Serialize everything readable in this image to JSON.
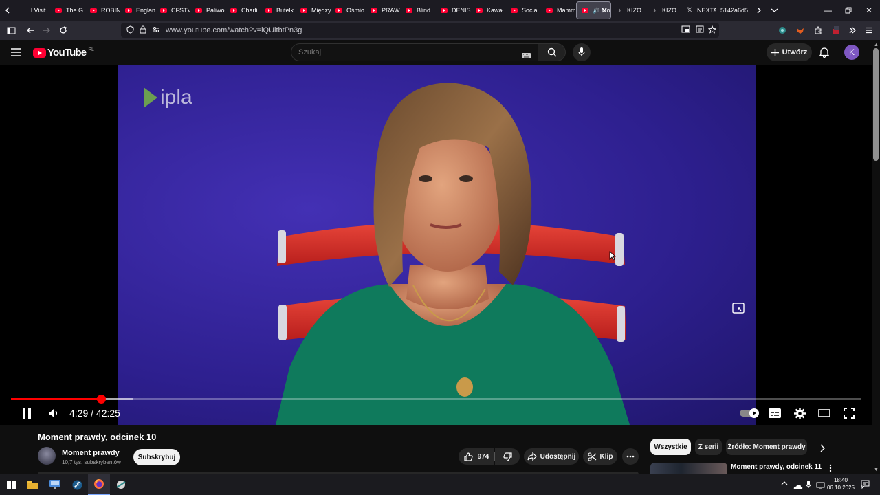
{
  "browser": {
    "tabs": [
      {
        "label": "l Visit",
        "icon": "favicon"
      },
      {
        "label": "The G",
        "icon": "youtube-icon"
      },
      {
        "label": "ROBIN",
        "icon": "youtube-icon"
      },
      {
        "label": "Englan",
        "icon": "youtube-icon"
      },
      {
        "label": "CFSTV",
        "icon": "youtube-icon"
      },
      {
        "label": "Paliwo",
        "icon": "youtube-icon"
      },
      {
        "label": "Charli",
        "icon": "youtube-icon"
      },
      {
        "label": "Butelk",
        "icon": "youtube-icon"
      },
      {
        "label": "Między",
        "icon": "youtube-icon"
      },
      {
        "label": "Ośmio",
        "icon": "youtube-icon"
      },
      {
        "label": "PRAW",
        "icon": "youtube-icon"
      },
      {
        "label": "Blind",
        "icon": "youtube-icon"
      },
      {
        "label": "DENIS",
        "icon": "youtube-icon"
      },
      {
        "label": "Kawał",
        "icon": "youtube-icon"
      },
      {
        "label": "Social",
        "icon": "youtube-icon"
      },
      {
        "label": "Mamm",
        "icon": "youtube-icon"
      },
      {
        "label": "Mo",
        "icon": "youtube-icon",
        "active": true
      },
      {
        "label": "KIZO",
        "icon": "tiktok-icon"
      },
      {
        "label": "KIZO",
        "icon": "tiktok-icon"
      },
      {
        "label": "NEXTA",
        "icon": "x-icon"
      },
      {
        "label": "5142a6d5",
        "icon": "none"
      }
    ],
    "url": "www.youtube.com/watch?v=iQUltbtPn3g"
  },
  "youtube": {
    "logo_text": "YouTube",
    "region": "PL",
    "search_placeholder": "Szukaj",
    "create_label": "Utwórz",
    "avatar_letter": "K",
    "accent": "#ff0033"
  },
  "player": {
    "watermark": "ipla",
    "time": "4:29 / 42:25",
    "progress_fraction": 0.106,
    "buffered_fraction": 0.143
  },
  "video": {
    "title": "Moment prawdy, odcinek 10",
    "channel": "Moment prawdy",
    "subscribers": "10,7 tys. subskrybentów",
    "subscribe_label": "Subskrybuj",
    "likes": "974",
    "share_label": "Udostępnij",
    "clip_label": "Klip"
  },
  "sidebar": {
    "chips": [
      "Wszystkie",
      "Z serii",
      "Źródło: Moment prawdy"
    ],
    "next_title": "Moment prawdy, odcinek 11",
    "next_channel": "Moment prawdy"
  },
  "taskbar": {
    "time": "18:40",
    "date": "06.10.2025"
  }
}
